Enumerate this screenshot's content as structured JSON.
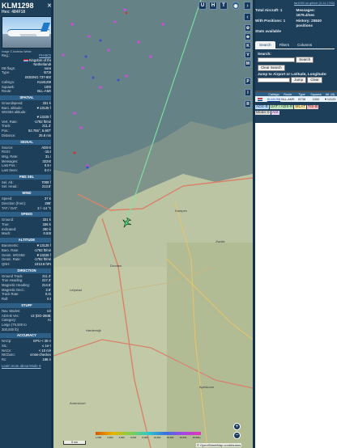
{
  "aircraft": {
    "callsign": "KLM1298",
    "hex_line": "Hex: 484F18",
    "photo_credit": "Image © Andreas Weiler",
    "photo_alt": "KLM airplane photo"
  },
  "info": {
    "reg_label": "Reg.:",
    "reg_value": "PH-BCB",
    "country_line1": "Kingdom of the",
    "country_line2": "Netherlands",
    "dbflags_label": "DB flags:",
    "dbflags_value": "none",
    "type_label": "Type:",
    "type_value": "B738",
    "type_desc": "BOEING 737-800",
    "callsign_label": "Callsign:",
    "callsign_value": "KLM1298",
    "squawk_label": "Squawk:",
    "squawk_value": "1000",
    "route_label": "Route:",
    "route_value": "BLL-AMS"
  },
  "spatial": {
    "title": "SPATIAL",
    "rows": [
      {
        "k": "Groundspeed:",
        "v": "331 kt"
      },
      {
        "k": "Baro. altitude:",
        "v": "▼13125 ft"
      },
      {
        "k": "WGS84 altitude:",
        "v": ""
      },
      {
        "k": "",
        "v": "▼13225 ft"
      },
      {
        "k": "Vert. Rate:",
        "v": "-1792 ft/min"
      },
      {
        "k": "Track:",
        "v": "211.3°"
      },
      {
        "k": "Pos.:",
        "v": "52.755°, 5.807°"
      },
      {
        "k": "Distance:",
        "v": "25.8 nmi"
      }
    ]
  },
  "signal": {
    "title": "SIGNAL",
    "rows": [
      {
        "k": "Source:",
        "v": "ADS-B"
      },
      {
        "k": "RSSI:",
        "v": "-15.6"
      },
      {
        "k": "Msg. Rate:",
        "v": "31.4"
      },
      {
        "k": "Messages:",
        "v": "32240"
      },
      {
        "k": "Last Pos.:",
        "v": "0.9 s"
      },
      {
        "k": "Last Seen:",
        "v": "0.0 s"
      }
    ]
  },
  "fmssel": {
    "title": "FMS SEL",
    "rows": [
      {
        "k": "Sel. Alt.:",
        "v": "7008 ft"
      },
      {
        "k": "Sel. Head.:",
        "v": "213.8°"
      }
    ]
  },
  "wind": {
    "title": "WIND",
    "rows": [
      {
        "k": "Speed:",
        "v": "37 kt"
      },
      {
        "k": "Direction (from):",
        "v": "298°"
      },
      {
        "k": "TAT / OAT:",
        "v": "2 / -14 °C"
      }
    ]
  },
  "speed": {
    "title": "SPEED",
    "rows": [
      {
        "k": "Ground:",
        "v": "331 kt"
      },
      {
        "k": "True:",
        "v": "336 kt"
      },
      {
        "k": "Indicated:",
        "v": "280 kt"
      },
      {
        "k": "Mach:",
        "v": "0.536"
      }
    ]
  },
  "altitude": {
    "title": "ALTITUDE",
    "rows": [
      {
        "k": "Barometric:",
        "v": "▼13125 ft"
      },
      {
        "k": "Baro. Rate:",
        "v": "-1792 ft/min"
      },
      {
        "k": "Geom. WGS84:",
        "v": "▼13225 ft"
      },
      {
        "k": "Geom. Rate:",
        "v": "-1792 ft/min"
      },
      {
        "k": "QNH:",
        "v": "1013.6 hPa"
      }
    ]
  },
  "direction": {
    "title": "DIRECTION",
    "rows": [
      {
        "k": "Ground Track:",
        "v": "211.3°"
      },
      {
        "k": "True Heading:",
        "v": "217.3°"
      },
      {
        "k": "Magnetic Heading:",
        "v": "214.5°"
      },
      {
        "k": "Magnetic Decl.:",
        "v": "2.8°"
      },
      {
        "k": "Track Rate:",
        "v": "0.03"
      },
      {
        "k": "Roll:",
        "v": "0.5"
      }
    ]
  },
  "stuff": {
    "title": "STUFF",
    "rows": [
      {
        "k": "Nav. Modes:",
        "v": "n/a"
      },
      {
        "k": "ADS-B Ver.:",
        "v": "v2 (DO-260B)"
      },
      {
        "k": "Category:",
        "v": "A3"
      },
      {
        "k": "Large (75,000 to",
        "v": ""
      },
      {
        "k": "300,000 lb)",
        "v": ""
      }
    ]
  },
  "accuracy": {
    "title": "ACCURACY",
    "rows": [
      {
        "k": "NACp:",
        "v": "EPU < 30 m"
      },
      {
        "k": "SIL:",
        "v": "≤ 1e-7"
      },
      {
        "k": "NACv:",
        "v": "< 10 m/s"
      },
      {
        "k": "NICbaro:",
        "v": "cross-checked"
      },
      {
        "k": "Rc:",
        "v": "186 m"
      }
    ]
  },
  "footer_link": "Learn more about Mode S",
  "map": {
    "top_buttons": [
      "U",
      "H",
      "T"
    ],
    "side_buttons": [
      "K",
      "V",
      "M",
      "P",
      "I",
      "R"
    ],
    "zoom_in": "+",
    "zoom_out": "−",
    "scale_label": "5 nm",
    "altitude_legend": [
      "1,000",
      "2,000",
      "4,000",
      "6,000",
      "8,000",
      "10,000",
      "20,000",
      "30,000",
      "40,000+"
    ],
    "attribution": "© OpenStreetMap contributors",
    "place_names": [
      "Kampen",
      "Dronten",
      "Harderwijk",
      "Zwolle",
      "Lelystad",
      "Apeldoorn",
      "Amersfoort"
    ]
  },
  "right": {
    "github_link": "tar1090 on github (3.14.1765)",
    "total_aircraft_label": "Total Aircraft:",
    "total_aircraft_value": "1",
    "messages_label": "Messages:",
    "messages_value": "1676.4/sec",
    "with_positions_label": "With Positions:",
    "with_positions_value": "1",
    "history_label": "History:",
    "history_value": "25840 positions",
    "stats_available": "Stats available",
    "tabs": [
      "Search",
      "Filters",
      "Columns"
    ],
    "search_label": "Search:",
    "search_button": "Search",
    "clear_search_button": "Clear Search",
    "jump_label": "Jump to Airport or Latitude, Longitude:",
    "jump_button": "Jump",
    "clear_button": "Clear"
  },
  "table": {
    "headers": [
      "",
      "Callsign",
      "Route",
      "Type",
      "Squawk",
      "Alt. (ft)"
    ],
    "rows": [
      [
        "",
        "KLM1298",
        "BLL-AMS",
        "B738",
        "1000",
        "▼13125"
      ]
    ]
  },
  "sources": {
    "line1": [
      "ADS-B",
      "UAT / ADS-R",
      "MLAT",
      "TIS-B"
    ],
    "line2": [
      "Mode-S",
      "AIS"
    ]
  },
  "colors": {
    "panel": "#1d3f5a",
    "section": "#2e5f86",
    "track": "#7fe3a0",
    "map_bg": "#bcc5a3"
  }
}
